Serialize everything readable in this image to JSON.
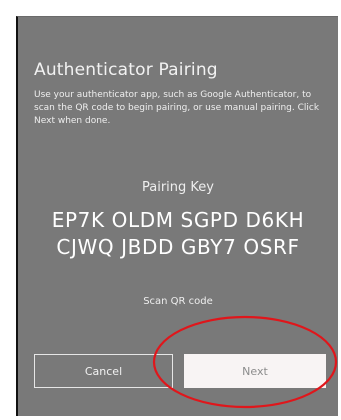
{
  "dialog": {
    "title": "Authenticator Pairing",
    "description": "Use your authenticator app, such as Google Authenticator, to scan the QR code to begin pairing, or use manual pairing. Click Next when done."
  },
  "pairing": {
    "label": "Pairing Key",
    "key_line_1": "EP7K OLDM SGPD D6KH",
    "key_line_2": "CJWQ JBDD GBY7 OSRF"
  },
  "scan_link": "Scan QR code",
  "buttons": {
    "cancel": "Cancel",
    "next": "Next"
  },
  "colors": {
    "panel_background": "#797979",
    "annotation_circle": "#e0161b"
  }
}
